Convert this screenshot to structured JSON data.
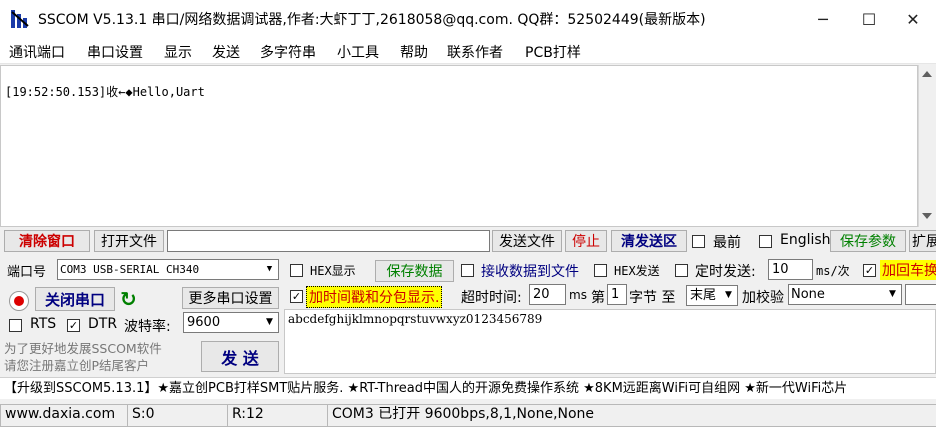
{
  "window": {
    "title": "SSCOM V5.13.1 串口/网络数据调试器,作者:大虾丁丁,2618058@qq.com. QQ群：52502449(最新版本)",
    "minimize": "─",
    "maximize": "☐",
    "close": "✕"
  },
  "menu": [
    "通讯端口",
    "串口设置",
    "显示",
    "发送",
    "多字符串",
    "小工具",
    "帮助",
    "联系作者",
    "PCB打样"
  ],
  "receive": {
    "line": "[19:52:50.153]收←◆Hello,Uart"
  },
  "toolbar": {
    "clear_window": "清除窗口",
    "open_file": "打开文件",
    "file_path": "",
    "send_file": "发送文件",
    "stop": "停止",
    "clear_send": "清发送区",
    "topmost": "最前",
    "english": "English",
    "save_params": "保存参数",
    "expand": "扩展"
  },
  "port": {
    "port_label": "端口号",
    "port_value": "COM3 USB-SERIAL CH340",
    "open_close_button": "关闭串口",
    "more_settings": "更多串口设置",
    "rts_label": "RTS",
    "dtr_label": "DTR",
    "rts_checked": false,
    "dtr_checked": true,
    "baud_label": "波特率:",
    "baud_value": "9600",
    "promo_text": "为了更好地发展SSCOM软件\n请您注册嘉立创P结尾客户",
    "send_button": "发 送"
  },
  "options": {
    "hex_display": "HEX显示",
    "save_data": "保存数据",
    "recv_to_file": "接收数据到文件",
    "hex_send": "HEX发送",
    "timed_send": "定时发送:",
    "interval_value": "10",
    "interval_unit": "ms/次",
    "add_crlf": "加回车换行",
    "timestamp": "加时间戳和分包显示.",
    "timeout_label": "超时时间:",
    "timeout_value": "20",
    "timeout_unit": "ms",
    "byte_prefix": "第",
    "byte_value": "1",
    "byte_label": "字节 至",
    "end_value": "末尾",
    "checksum_label": "加校验",
    "checksum_value": "None"
  },
  "send": {
    "text": "abcdefghijklmnopqrstuvwxyz0123456789"
  },
  "ticker": {
    "text": "【升级到SSCOM5.13.1】★嘉立创PCB打样SMT贴片服务. ★RT-Thread中国人的开源免费操作系统 ★8KM远距离WiFi可自组网 ★新一代WiFi芯片"
  },
  "status": {
    "website": "www.daxia.com",
    "sent": "S:0",
    "received": "R:12",
    "port_status": "COM3 已打开  9600bps,8,1,None,None"
  },
  "colors": {
    "accent_red": "#cc0000",
    "accent_green": "#008000",
    "accent_blue": "#000080",
    "highlight_yellow": "#ffff00"
  }
}
